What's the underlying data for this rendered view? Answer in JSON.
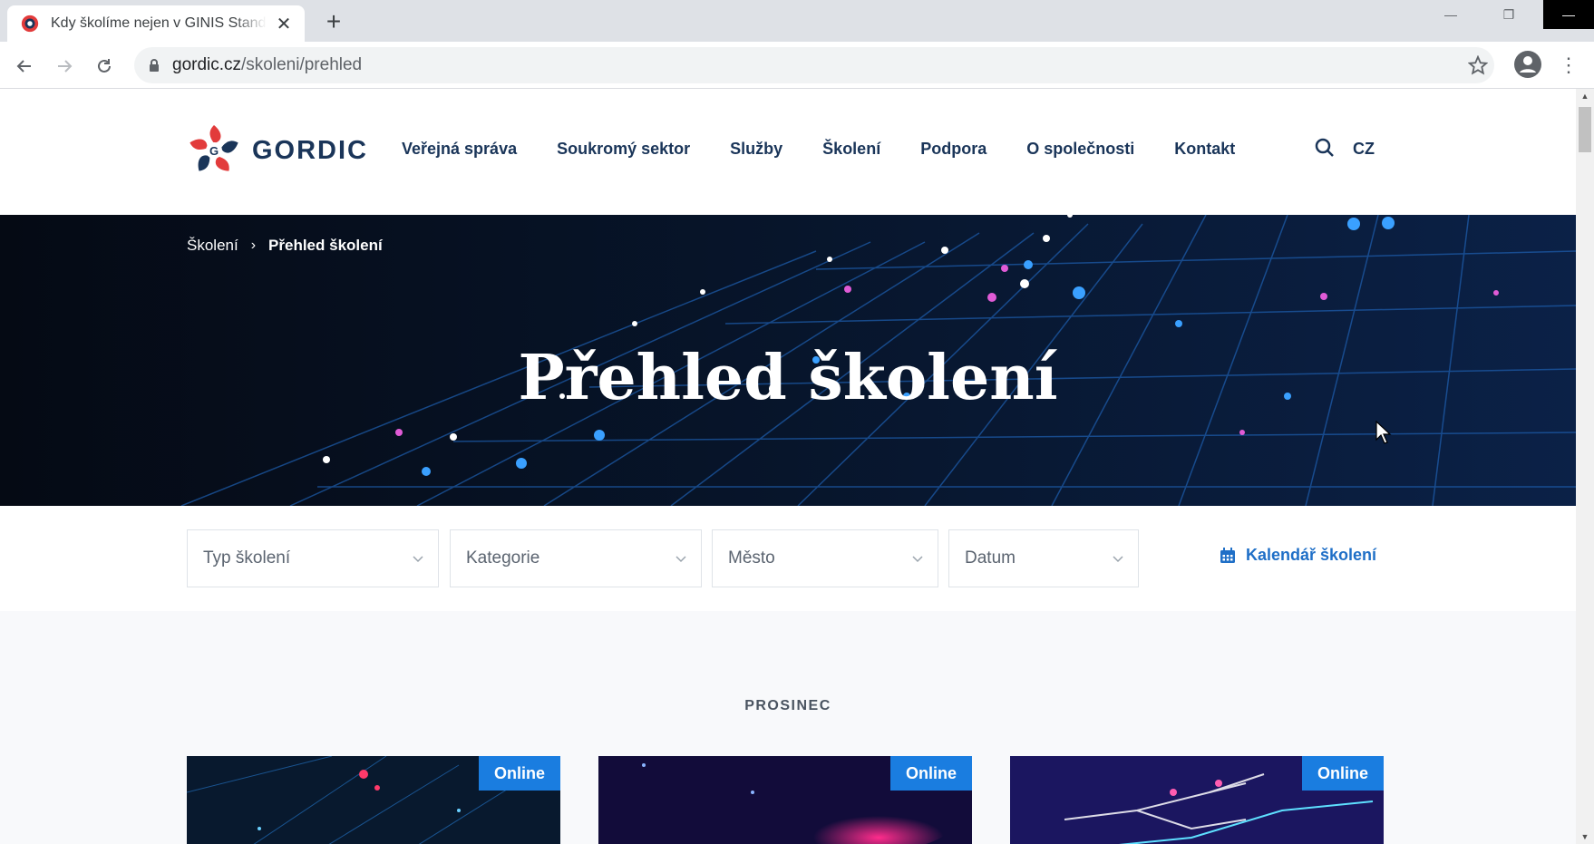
{
  "browser": {
    "tab_title": "Kdy školíme nejen v GINIS Standard",
    "new_tab_symbol": "+",
    "url_domain": "gordic.cz",
    "url_path": "/skoleni/prehled"
  },
  "header": {
    "logo_text": "GORDIC",
    "nav": [
      "Veřejná správa",
      "Soukromý sektor",
      "Služby",
      "Školení",
      "Podpora",
      "O společnosti",
      "Kontakt"
    ],
    "lang": "CZ"
  },
  "hero": {
    "breadcrumb_root": "Školení",
    "breadcrumb_current": "Přehled školení",
    "title": "Přehled školení"
  },
  "filters": {
    "type": "Typ školení",
    "category": "Kategorie",
    "city": "Město",
    "date": "Datum",
    "calendar_link": "Kalendář školení"
  },
  "content": {
    "month": "PROSINEC",
    "cards": [
      {
        "badge": "Online"
      },
      {
        "badge": "Online"
      },
      {
        "badge": "Online"
      }
    ]
  },
  "colors": {
    "brand_navy": "#1a3559",
    "accent_blue": "#1a7de0",
    "link_blue": "#1f6fc7",
    "hero_bg": "#06101f"
  }
}
